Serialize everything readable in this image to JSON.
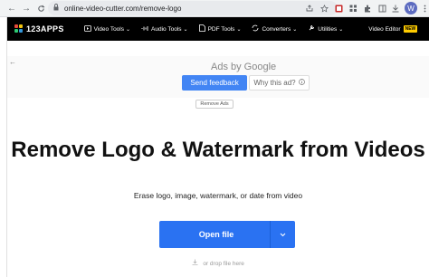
{
  "browser": {
    "url": "online-video-cutter.com/remove-logo",
    "back_icon": "←",
    "forward_icon": "→",
    "reload_icon": "C",
    "avatar_letter": "W"
  },
  "app_nav": {
    "logo": "123APPS",
    "items": [
      {
        "label": "Video Tools",
        "icon": "video-icon"
      },
      {
        "label": "Audio Tools",
        "icon": "audio-icon"
      },
      {
        "label": "PDF Tools",
        "icon": "pdf-icon"
      },
      {
        "label": "Converters",
        "icon": "converters-icon"
      },
      {
        "label": "Utilities",
        "icon": "utilities-icon"
      }
    ],
    "video_editor": "Video Editor",
    "new_badge": "NEW"
  },
  "ad": {
    "ads_by": "Ads by Google",
    "send_feedback": "Send feedback",
    "why_this_ad": "Why this ad?",
    "remove_ads": "Remove Ads"
  },
  "main": {
    "title": "Remove Logo & Watermark from Videos",
    "subtitle": "Erase logo, image, watermark, or date from video",
    "open_file": "Open file",
    "drop_hint": "or drop file here"
  },
  "colors": {
    "primary_button": "#2a72f2",
    "feedback_button": "#4285f4",
    "nav_background": "#000000",
    "new_badge": "#ffcc00"
  }
}
